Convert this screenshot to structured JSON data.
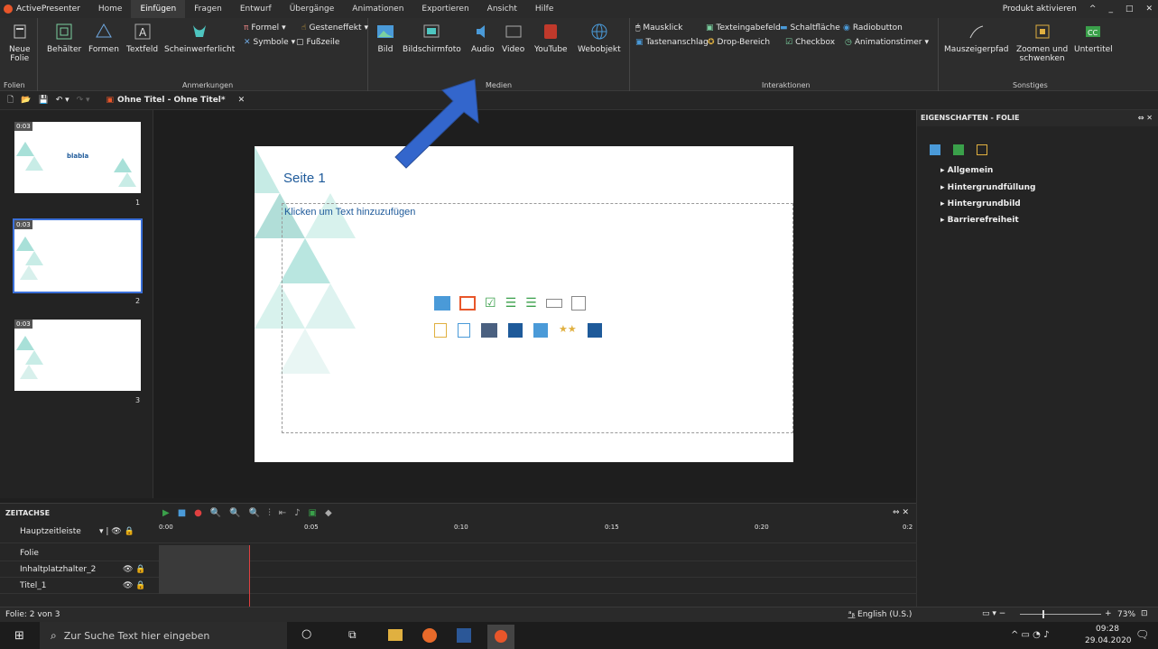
{
  "titlebar": {
    "app_name": "ActivePresenter",
    "tabs": [
      "Home",
      "Einfügen",
      "Fragen",
      "Entwurf",
      "Übergänge",
      "Animationen",
      "Exportieren",
      "Ansicht",
      "Hilfe"
    ],
    "active_tab": "Einfügen",
    "activate": "Produkt aktivieren"
  },
  "ribbon": {
    "folien": {
      "label": "Folien",
      "new_slide": "Neue",
      "new_slide2": "Folie"
    },
    "anmerkungen": {
      "label": "Anmerkungen",
      "behaelter": "Behälter",
      "formen": "Formen",
      "textfeld": "Textfeld",
      "scheinwerfer": "Scheinwerferlicht",
      "formel": "Formel",
      "gesteneffekt": "Gesteneffekt",
      "symbole": "Symbole",
      "fusszeile": "Fußzeile"
    },
    "medien": {
      "label": "Medien",
      "bild": "Bild",
      "bildschirmfoto": "Bildschirmfoto",
      "audio": "Audio",
      "video": "Video",
      "youtube": "YouTube",
      "webobjekt": "Webobjekt"
    },
    "interaktionen": {
      "label": "Interaktionen",
      "mausklick": "Mausklick",
      "texteingabefeld": "Texteingabefeld",
      "schaltflaeche": "Schaltfläche",
      "radiobutton": "Radiobutton",
      "tastenanschlag": "Tastenanschlag",
      "dropbereich": "Drop-Bereich",
      "checkbox": "Checkbox",
      "animationstimer": "Animationstimer"
    },
    "sonstiges": {
      "label": "Sonstiges",
      "mauszeigerpfad": "Mauszeigerpfad",
      "zoomen": "Zoomen und",
      "zoomen2": "schwenken",
      "untertitel": "Untertitel"
    }
  },
  "document": {
    "tab_title": "Ohne Titel - Ohne Titel*"
  },
  "slides": [
    {
      "num": "1",
      "badge": "0:03",
      "title": "blabla"
    },
    {
      "num": "2",
      "badge": "0:03"
    },
    {
      "num": "3",
      "badge": "0:03"
    }
  ],
  "slide": {
    "title": "Seite 1",
    "placeholder": "Klicken um Text hinzuzufügen"
  },
  "properties": {
    "header": "EIGENSCHAFTEN - FOLIE",
    "items": [
      "Allgemein",
      "Hintergrundfüllung",
      "Hintergrundbild",
      "Barrierefreiheit"
    ]
  },
  "timeline": {
    "header": "ZEITACHSE",
    "main": "Hauptzeitleiste",
    "ticks": [
      "0:00",
      "0:05",
      "0:10",
      "0:15",
      "0:20",
      "0:2"
    ],
    "rows": [
      "Folie",
      "Inhaltplatzhalter_2",
      "Titel_1"
    ]
  },
  "status": {
    "slide": "Folie: 2 von 3",
    "lang": "English (U.S.)",
    "zoom": "73%"
  },
  "taskbar": {
    "search": "Zur Suche Text hier eingeben",
    "time": "09:28",
    "date": "29.04.2020"
  },
  "colors": {
    "accent": "#3a6fd8",
    "triangle": "#a8e0d8",
    "title_blue": "#1e5a9a",
    "arrow": "#3366cc"
  }
}
